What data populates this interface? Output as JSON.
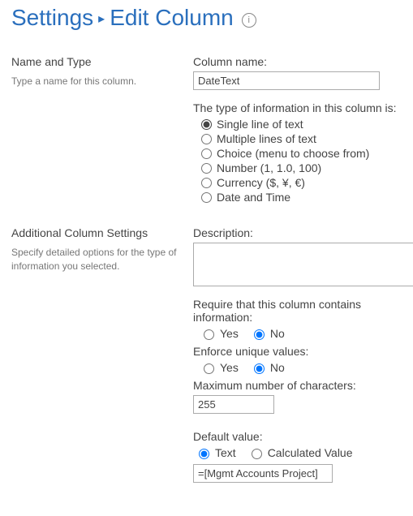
{
  "heading": {
    "settings": "Settings",
    "page": "Edit Column"
  },
  "sections": {
    "nameAndType": {
      "title": "Name and Type",
      "desc": "Type a name for this column."
    },
    "additional": {
      "title": "Additional Column Settings",
      "desc": "Specify detailed options for the type of information you selected."
    }
  },
  "labels": {
    "columnName": "Column name:",
    "typeIntro": "The type of information in this column is:",
    "description": "Description:",
    "require": "Require that this column contains information:",
    "enforce": "Enforce unique values:",
    "maxChars": "Maximum number of characters:",
    "defaultValue": "Default value:",
    "yes": "Yes",
    "no": "No",
    "text": "Text",
    "calculated": "Calculated Value"
  },
  "values": {
    "columnName": "DateText",
    "maxChars": "255",
    "defaultValue": "=[Mgmt Accounts Project]"
  },
  "columnTypes": [
    "Single line of text",
    "Multiple lines of text",
    "Choice (menu to choose from)",
    "Number (1, 1.0, 100)",
    "Currency ($, ¥, €)",
    "Date and Time"
  ],
  "state": {
    "selectedType": 0,
    "require": "no",
    "enforce": "no",
    "defaultMode": "text"
  }
}
